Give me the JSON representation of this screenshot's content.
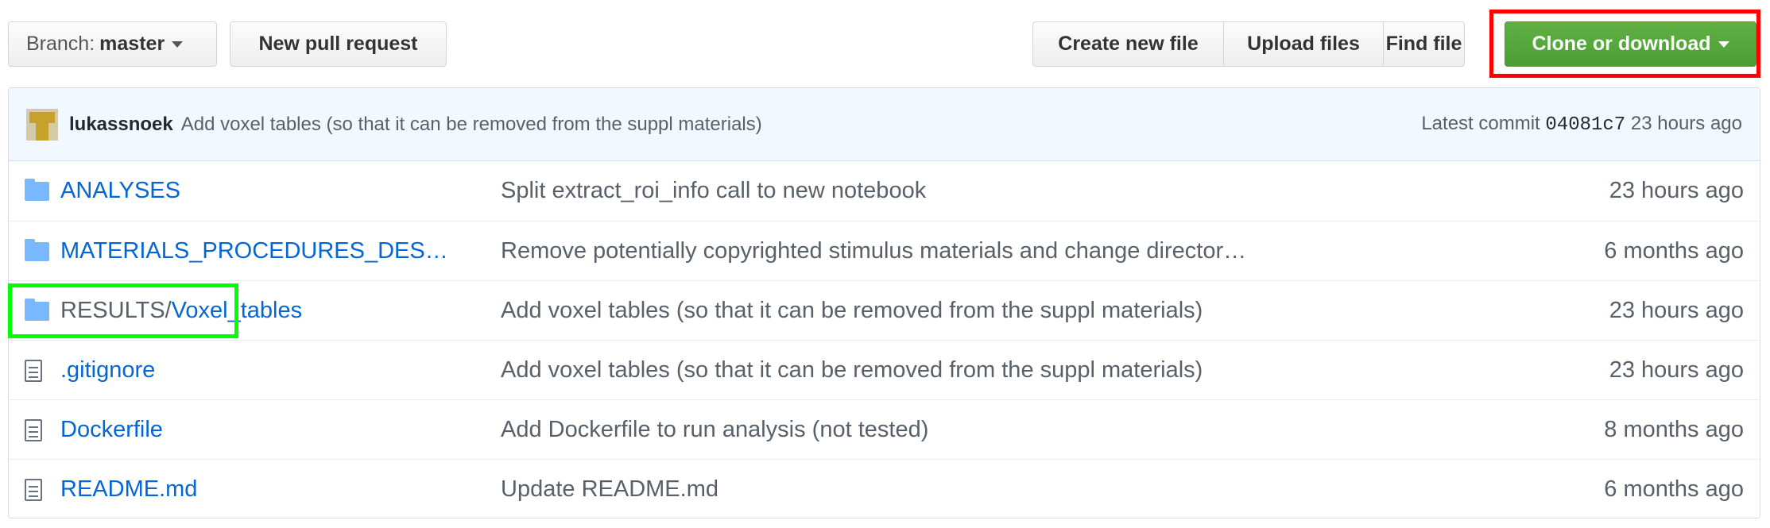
{
  "toolbar": {
    "branch_prefix": "Branch:",
    "branch_name": "master",
    "new_pr_label": "New pull request",
    "create_file_label": "Create new file",
    "upload_files_label": "Upload files",
    "find_file_label": "Find file",
    "clone_label": "Clone or download"
  },
  "commit": {
    "author": "lukassnoek",
    "message": "Add voxel tables (so that it can be removed from the suppl materials)",
    "latest_label": "Latest commit",
    "sha": "04081c7",
    "age": "23 hours ago"
  },
  "files": [
    {
      "type": "folder-icon",
      "name": "ANALYSES",
      "name_prefix": "",
      "message": "Split extract_roi_info call to new notebook",
      "age": "23 hours ago"
    },
    {
      "type": "folder-icon",
      "name": "MATERIALS_PROCEDURES_DES…",
      "name_prefix": "",
      "message": "Remove potentially copyrighted stimulus materials and change director…",
      "age": "6 months ago"
    },
    {
      "type": "folder-icon",
      "name": "Voxel_tables",
      "name_prefix": "RESULTS/",
      "message": "Add voxel tables (so that it can be removed from the suppl materials)",
      "age": "23 hours ago"
    },
    {
      "type": "file-icon",
      "name": ".gitignore",
      "name_prefix": "",
      "message": "Add voxel tables (so that it can be removed from the suppl materials)",
      "age": "23 hours ago"
    },
    {
      "type": "file-icon",
      "name": "Dockerfile",
      "name_prefix": "",
      "message": "Add Dockerfile to run analysis (not tested)",
      "age": "8 months ago"
    },
    {
      "type": "file-icon",
      "name": "README.md",
      "name_prefix": "",
      "message": "Update README.md",
      "age": "6 months ago"
    }
  ],
  "colors": {
    "link": "#0366d6",
    "clone_button": "#55a73c",
    "highlight_red": "#ff0000",
    "highlight_green": "#00ff00"
  }
}
